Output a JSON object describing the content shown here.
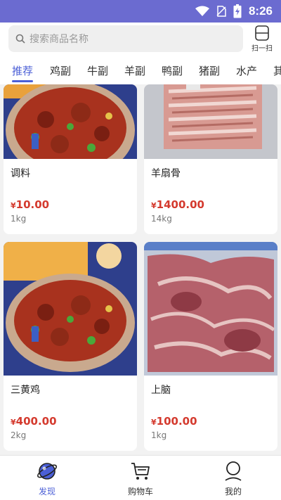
{
  "status": {
    "time": "8:26"
  },
  "search": {
    "placeholder": "搜索商品名称",
    "scan_label": "扫一扫"
  },
  "tabs": [
    "推荐",
    "鸡副",
    "牛副",
    "羊副",
    "鸭副",
    "猪副",
    "水产",
    "其"
  ],
  "products": [
    {
      "name": "调料",
      "currency": "¥",
      "price": "10.00",
      "unit": "1kg",
      "image": "braised-chicken-dish"
    },
    {
      "name": "羊扇骨",
      "currency": "¥",
      "price": "1400.00",
      "unit": "14kg",
      "image": "frozen-lamb-ribs"
    },
    {
      "name": "三黄鸡",
      "currency": "¥",
      "price": "400.00",
      "unit": "2kg",
      "image": "braised-chicken-dish"
    },
    {
      "name": "上脑",
      "currency": "¥",
      "price": "100.00",
      "unit": "1kg",
      "image": "frozen-beef-chuck"
    }
  ],
  "bottom_nav": [
    {
      "label": "发现",
      "icon": "planet-icon",
      "active": true
    },
    {
      "label": "购物车",
      "icon": "cart-icon",
      "active": false
    },
    {
      "label": "我的",
      "icon": "person-icon",
      "active": false
    }
  ],
  "colors": {
    "accent": "#4b5fd6",
    "price": "#d43a2e",
    "statusbar": "#6b6bd0"
  }
}
